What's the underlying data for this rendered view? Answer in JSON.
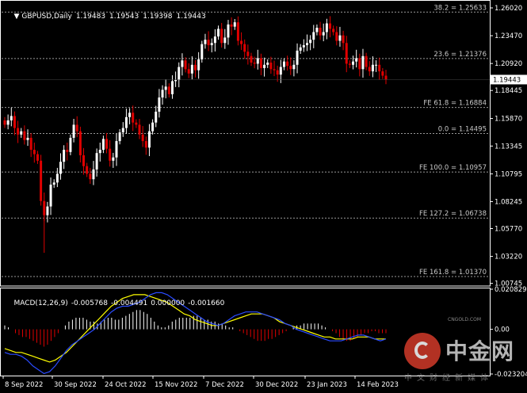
{
  "header": {
    "symbol": "GBPUSD,Daily",
    "open": "1.19483",
    "high": "1.19543",
    "low": "1.19398",
    "close": "1.19443"
  },
  "price_axis": [
    "1.26020",
    "1.23470",
    "1.20920",
    "1.18445",
    "1.15870",
    "1.13345",
    "1.10795",
    "1.08245",
    "1.05770",
    "1.03220",
    "1.00745"
  ],
  "current_price": "1.19443",
  "fib_lines": [
    {
      "label": "38.2 = 1.25633",
      "value": 1.25633
    },
    {
      "label": "23.6 = 1.21376",
      "value": 1.21376
    },
    {
      "label": "FE 61.8 = 1.16884",
      "value": 1.16884
    },
    {
      "label": "0.0 = 1.14495",
      "value": 1.14495
    },
    {
      "label": "FE 100.0 = 1.10957",
      "value": 1.10957
    },
    {
      "label": "FE 127.2 = 1.06738",
      "value": 1.06738
    },
    {
      "label": "FE 161.8 = 1.01370",
      "value": 1.0137
    }
  ],
  "time_axis": [
    "8 Sep 2022",
    "30 Sep 2022",
    "24 Oct 2022",
    "15 Nov 2022",
    "7 Dec 2022",
    "30 Dec 2022",
    "23 Jan 2023",
    "14 Feb 2023"
  ],
  "macd": {
    "label": "MACD(12,26,9)",
    "v1": "-0.005768",
    "v2": "-0.004491",
    "v3": "0.000000",
    "v4": "-0.001660",
    "axis": [
      "0.020829",
      "0.00",
      "-0.023204"
    ]
  },
  "watermark": {
    "brand": "中金网",
    "domain": "CNGOLD.COM",
    "tagline": "中文财经新媒体"
  },
  "colors": {
    "background": "#000000",
    "bull": "#ffffff",
    "bear": "#e00000",
    "macd_main": "#2a4bff",
    "macd_signal": "#ffff00",
    "grid": "#808080"
  },
  "chart_data": {
    "type": "candlestick",
    "title": "GBPUSD,Daily",
    "ylim": [
      1.005,
      1.266
    ],
    "closes": [
      1.153,
      1.157,
      1.161,
      1.15,
      1.144,
      1.147,
      1.139,
      1.141,
      1.13,
      1.126,
      1.12,
      1.083,
      1.07,
      1.078,
      1.098,
      1.1,
      1.108,
      1.119,
      1.13,
      1.128,
      1.141,
      1.153,
      1.147,
      1.125,
      1.115,
      1.108,
      1.103,
      1.112,
      1.127,
      1.13,
      1.14,
      1.131,
      1.12,
      1.123,
      1.138,
      1.146,
      1.15,
      1.16,
      1.164,
      1.155,
      1.153,
      1.144,
      1.138,
      1.132,
      1.147,
      1.155,
      1.165,
      1.178,
      1.185,
      1.188,
      1.181,
      1.193,
      1.194,
      1.206,
      1.212,
      1.204,
      1.2,
      1.208,
      1.203,
      1.213,
      1.227,
      1.231,
      1.226,
      1.228,
      1.234,
      1.241,
      1.228,
      1.233,
      1.245,
      1.243,
      1.247,
      1.23,
      1.227,
      1.22,
      1.216,
      1.21,
      1.209,
      1.214,
      1.205,
      1.208,
      1.21,
      1.204,
      1.203,
      1.199,
      1.206,
      1.211,
      1.207,
      1.204,
      1.208,
      1.221,
      1.224,
      1.226,
      1.228,
      1.231,
      1.238,
      1.242,
      1.235,
      1.238,
      1.246,
      1.241,
      1.238,
      1.23,
      1.235,
      1.228,
      1.209,
      1.208,
      1.211,
      1.214,
      1.204,
      1.216,
      1.206,
      1.202,
      1.208,
      1.208,
      1.202,
      1.198,
      1.1944
    ],
    "macd_histogram": [
      0.002,
      0.001,
      0.0,
      -0.002,
      -0.003,
      -0.004,
      -0.004,
      -0.005,
      -0.006,
      -0.007,
      -0.008,
      -0.009,
      -0.008,
      -0.006,
      -0.004,
      -0.002,
      0.0,
      0.002,
      0.004,
      0.005,
      0.006,
      0.006,
      0.006,
      0.005,
      0.004,
      0.004,
      0.003,
      0.004,
      0.005,
      0.006,
      0.006,
      0.005,
      0.005,
      0.006,
      0.007,
      0.008,
      0.009,
      0.01,
      0.01,
      0.009,
      0.008,
      0.006,
      0.004,
      0.002,
      0.001,
      0.001,
      0.002,
      0.004,
      0.005,
      0.006,
      0.006,
      0.006,
      0.006,
      0.007,
      0.007,
      0.006,
      0.005,
      0.005,
      0.004,
      0.004,
      0.003,
      0.003,
      0.002,
      0.001,
      0.001,
      0.0,
      -0.001,
      -0.002,
      -0.003,
      -0.004,
      -0.005,
      -0.006,
      -0.006,
      -0.006,
      -0.005,
      -0.005,
      -0.004,
      -0.003,
      -0.002,
      -0.001,
      0.0,
      0.001,
      0.002,
      0.002,
      0.003,
      0.003,
      0.003,
      0.003,
      0.003,
      0.002,
      0.001,
      0.0,
      -0.001,
      -0.002,
      -0.004,
      -0.005,
      -0.006,
      -0.006,
      -0.005,
      -0.004,
      -0.003,
      -0.002,
      -0.002,
      -0.001,
      -0.001,
      -0.002,
      -0.002,
      -0.002
    ],
    "macd_main": [
      -0.012,
      -0.013,
      -0.013,
      -0.014,
      -0.016,
      -0.019,
      -0.021,
      -0.023,
      -0.022,
      -0.019,
      -0.015,
      -0.011,
      -0.008,
      -0.006,
      -0.004,
      -0.002,
      0.0,
      0.003,
      0.006,
      0.009,
      0.011,
      0.012,
      0.012,
      0.013,
      0.014,
      0.016,
      0.018,
      0.019,
      0.019,
      0.018,
      0.016,
      0.014,
      0.012,
      0.01,
      0.008,
      0.006,
      0.004,
      0.003,
      0.002,
      0.003,
      0.005,
      0.007,
      0.008,
      0.009,
      0.009,
      0.009,
      0.008,
      0.007,
      0.006,
      0.005,
      0.003,
      0.002,
      0.0,
      -0.001,
      -0.002,
      -0.003,
      -0.004,
      -0.005,
      -0.006,
      -0.006,
      -0.006,
      -0.005,
      -0.004,
      -0.003,
      -0.003,
      -0.004,
      -0.005,
      -0.006,
      -0.005
    ],
    "macd_signal": [
      -0.01,
      -0.011,
      -0.012,
      -0.012,
      -0.013,
      -0.014,
      -0.015,
      -0.016,
      -0.017,
      -0.016,
      -0.014,
      -0.012,
      -0.009,
      -0.006,
      -0.003,
      0.0,
      0.003,
      0.006,
      0.009,
      0.012,
      0.014,
      0.016,
      0.017,
      0.018,
      0.018,
      0.018,
      0.017,
      0.016,
      0.015,
      0.014,
      0.012,
      0.01,
      0.008,
      0.007,
      0.005,
      0.004,
      0.003,
      0.002,
      0.002,
      0.003,
      0.004,
      0.005,
      0.006,
      0.007,
      0.008,
      0.008,
      0.008,
      0.007,
      0.006,
      0.004,
      0.003,
      0.002,
      0.001,
      0.0,
      -0.001,
      -0.002,
      -0.003,
      -0.004,
      -0.004,
      -0.005,
      -0.005,
      -0.005,
      -0.005,
      -0.004,
      -0.004,
      -0.004,
      -0.005,
      -0.005,
      -0.005
    ],
    "macd_ylim": [
      -0.023204,
      0.020829
    ]
  }
}
